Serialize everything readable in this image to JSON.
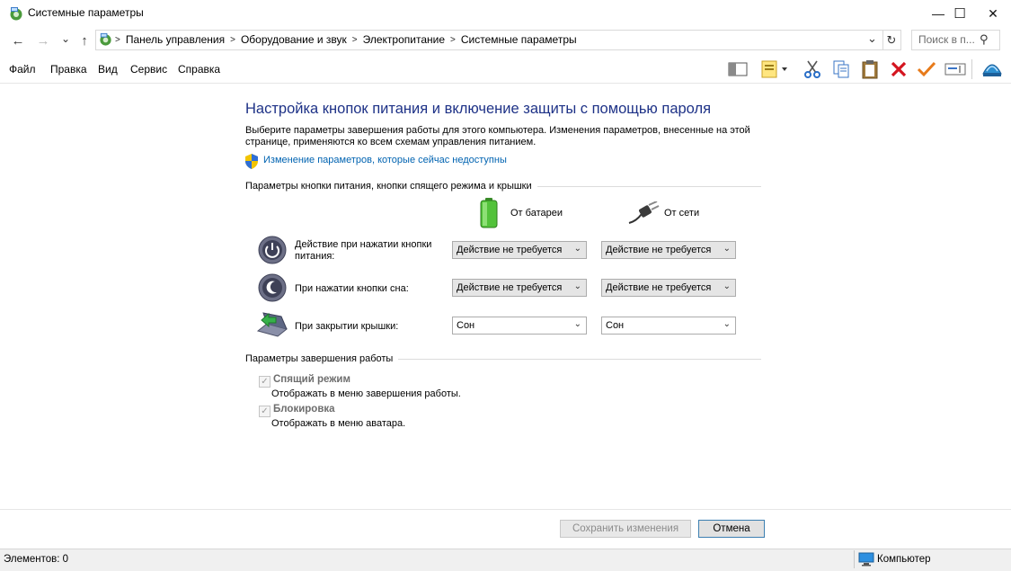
{
  "window": {
    "title": "Системные параметры",
    "minimize_glyph": "—",
    "maximize_glyph": "☐",
    "close_glyph": "✕"
  },
  "nav": {
    "back_glyph": "←",
    "forward_glyph": "→",
    "recent_glyph": "⌄",
    "up_glyph": "↑",
    "breadcrumb": [
      "Панель управления",
      "Оборудование и звук",
      "Электропитание",
      "Системные параметры"
    ],
    "breadcrumb_sep": ">",
    "dropdown_glyph": "⌄",
    "refresh_glyph": "↻",
    "search_placeholder": "Поиск в п...",
    "search_glyph": "⚲"
  },
  "menu": {
    "items": [
      "Файл",
      "Правка",
      "Вид",
      "Сервис",
      "Справка"
    ]
  },
  "toolbar": {
    "icons": [
      "layout-icon",
      "properties-icon",
      "cut-icon",
      "copy-icon",
      "paste-icon",
      "delete-icon",
      "checkmark-icon",
      "rename-icon",
      "options-icon"
    ]
  },
  "main": {
    "heading": "Настройка кнопок питания и включение защиты с помощью пароля",
    "intro": "Выберите параметры завершения работы для этого компьютера. Изменения параметров, внесенные на этой странице, применяются ко всем схемам управления питанием.",
    "link": "Изменение параметров, которые сейчас недоступны",
    "group1_title": "Параметры кнопки питания, кнопки спящего режима и крышки",
    "col_battery": "От батареи",
    "col_ac": "От сети",
    "rows": [
      {
        "label": "Действие при нажатии кнопки питания:",
        "battery": "Действие не требуется",
        "ac": "Действие не требуется"
      },
      {
        "label": "При нажатии кнопки сна:",
        "battery": "Действие не требуется",
        "ac": "Действие не требуется"
      },
      {
        "label": "При закрытии крышки:",
        "battery": "Сон",
        "ac": "Сон"
      }
    ],
    "select_glyph": "⌄",
    "group2_title": "Параметры завершения работы",
    "checkboxes": [
      {
        "title": "Спящий режим",
        "desc": "Отображать в меню завершения работы.",
        "checked": true
      },
      {
        "title": "Блокировка",
        "desc": "Отображать в меню аватара.",
        "checked": true
      }
    ],
    "check_glyph": "✓"
  },
  "footer": {
    "save_label": "Сохранить изменения",
    "cancel_label": "Отмена"
  },
  "status": {
    "left": "Элементов: 0",
    "right": "Компьютер"
  },
  "colors": {
    "heading": "#1e3287",
    "link": "#0063b1"
  }
}
